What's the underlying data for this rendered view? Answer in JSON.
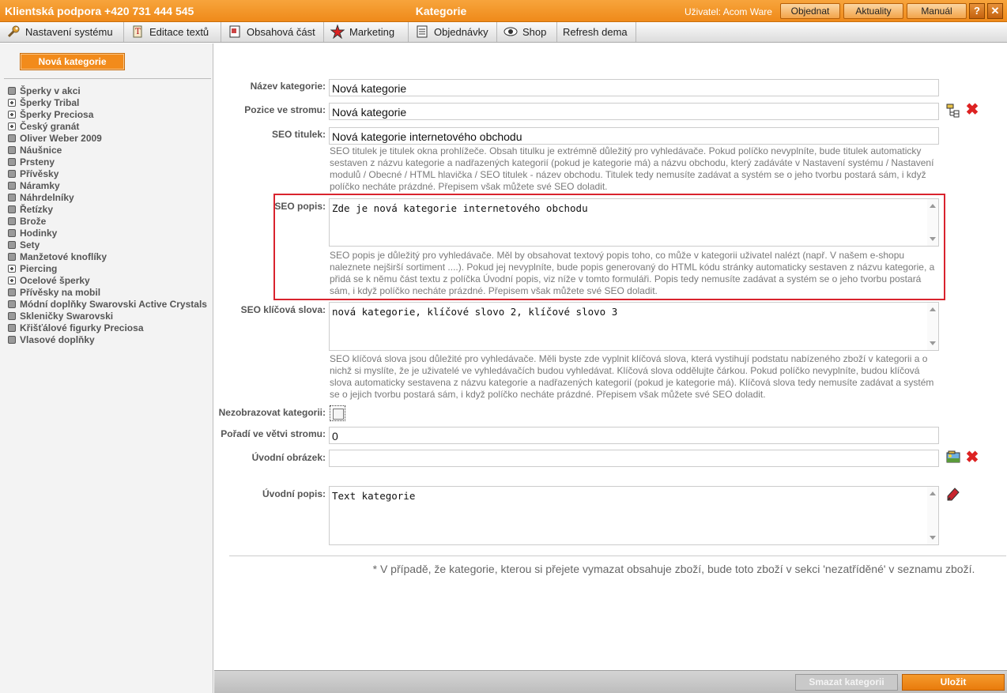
{
  "topbar": {
    "support": "Klientská podpora +420 731 444 545",
    "title": "Kategorie",
    "user_label": "Uživatel:",
    "user_name": "Acom Ware",
    "buttons": [
      "Objednat",
      "Aktuality",
      "Manuál"
    ],
    "help": "?",
    "close": "✕"
  },
  "menu": [
    {
      "label": "Nastavení systému",
      "icon": "wrench-icon"
    },
    {
      "label": "Editace textů",
      "icon": "text-edit-icon"
    },
    {
      "label": "Obsahová část",
      "icon": "page-icon"
    },
    {
      "label": "Marketing",
      "icon": "star-icon"
    },
    {
      "label": "Objednávky",
      "icon": "list-icon"
    },
    {
      "label": "Shop",
      "icon": "eye-icon"
    },
    {
      "label": "Refresh dema",
      "icon": ""
    }
  ],
  "sidebar": {
    "new_category": "Nová kategorie",
    "categories": [
      {
        "label": "Šperky v akci",
        "expandable": false
      },
      {
        "label": "Šperky Tribal",
        "expandable": true
      },
      {
        "label": "Šperky Preciosa",
        "expandable": true
      },
      {
        "label": "Český granát",
        "expandable": true
      },
      {
        "label": "Oliver Weber 2009",
        "expandable": false
      },
      {
        "label": "Náušnice",
        "expandable": false
      },
      {
        "label": "Prsteny",
        "expandable": false
      },
      {
        "label": "Přívěsky",
        "expandable": false
      },
      {
        "label": "Náramky",
        "expandable": false
      },
      {
        "label": "Náhrdelníky",
        "expandable": false
      },
      {
        "label": "Řetízky",
        "expandable": false
      },
      {
        "label": "Brože",
        "expandable": false
      },
      {
        "label": "Hodinky",
        "expandable": false
      },
      {
        "label": "Sety",
        "expandable": false
      },
      {
        "label": "Manžetové knoflíky",
        "expandable": false
      },
      {
        "label": "Piercing",
        "expandable": true
      },
      {
        "label": "Ocelové šperky",
        "expandable": true
      },
      {
        "label": "Přívěsky na mobil",
        "expandable": false
      },
      {
        "label": "Módní doplňky Swarovski Active Crystals",
        "expandable": false
      },
      {
        "label": "Skleničky Swarovski",
        "expandable": false
      },
      {
        "label": "Křišťálové figurky Preciosa",
        "expandable": false
      },
      {
        "label": "Vlasové doplňky",
        "expandable": false
      }
    ]
  },
  "form": {
    "name_label": "Název kategorie:",
    "name_value": "Nová kategorie",
    "tree_label": "Pozice ve stromu:",
    "tree_value": "Nová kategorie",
    "seo_title_label": "SEO titulek:",
    "seo_title_value": "Nová kategorie internetového obchodu",
    "seo_title_help": "SEO titulek je titulek okna prohlížeče. Obsah titulku je extrémně důležitý pro vyhledávače. Pokud políčko nevyplníte, bude titulek automaticky sestaven z názvu kategorie a nadřazených kategorií (pokud je kategorie má) a názvu obchodu, který zadáváte v Nastavení systému / Nastavení modulů / Obecné / HTML hlavička / SEO titulek - název obchodu. Titulek tedy nemusíte zadávat a systém se o jeho tvorbu postará sám, i když políčko necháte prázdné. Přepisem však můžete své SEO doladit.",
    "seo_desc_label": "SEO popis:",
    "seo_desc_value": "Zde je nová kategorie internetového obchodu",
    "seo_desc_help": "SEO popis je důležitý pro vyhledávače. Měl by obsahovat textový popis toho, co může v kategorii uživatel nalézt (např. V našem e-shopu naleznete nejširší sortiment ....). Pokud jej nevyplníte, bude popis generovaný do HTML kódu stránky automaticky sestaven z názvu kategorie, a přidá se k němu část textu z políčka Úvodní popis, viz níže v tomto formuláři. Popis tedy nemusíte zadávat a systém se o jeho tvorbu postará sám, i když políčko necháte prázdné. Přepisem však můžete své SEO doladit.",
    "seo_kw_label": "SEO klíčová slova:",
    "seo_kw_value": "nová kategorie, klíčové slovo 2, klíčové slovo 3",
    "seo_kw_help": "SEO klíčová slova jsou důležité pro vyhledávače. Měli byste zde vyplnit klíčová slova, která vystihují podstatu nabízeného zboží v kategorii a o nichž si myslíte, že je uživatelé ve vyhledávačích budou vyhledávat. Klíčová slova oddělujte čárkou. Pokud políčko nevyplníte, budou klíčová slova automaticky sestavena z názvu kategorie a nadřazených kategorií (pokud je kategorie má). Klíčová slova tedy nemusíte zadávat a systém se o jejich tvorbu postará sám, i když políčko necháte prázdné. Přepisem však můžete své SEO doladit.",
    "hide_label": "Nezobrazovat kategorii:",
    "order_label": "Pořadí ve větvi stromu:",
    "order_value": "0",
    "image_label": "Úvodní obrázek:",
    "image_value": "",
    "intro_label": "Úvodní popis:",
    "intro_value": "Text kategorie",
    "note": "* V případě, že kategorie, kterou si přejete vymazat obsahuje zboží, bude toto zboží v sekci 'nezatříděné' v seznamu zboží."
  },
  "bottom": {
    "delete_label": "Smazat kategorii",
    "save_label": "Uložit"
  },
  "colors": {
    "accent": "#f28b1b",
    "highlight": "#d9232e"
  }
}
